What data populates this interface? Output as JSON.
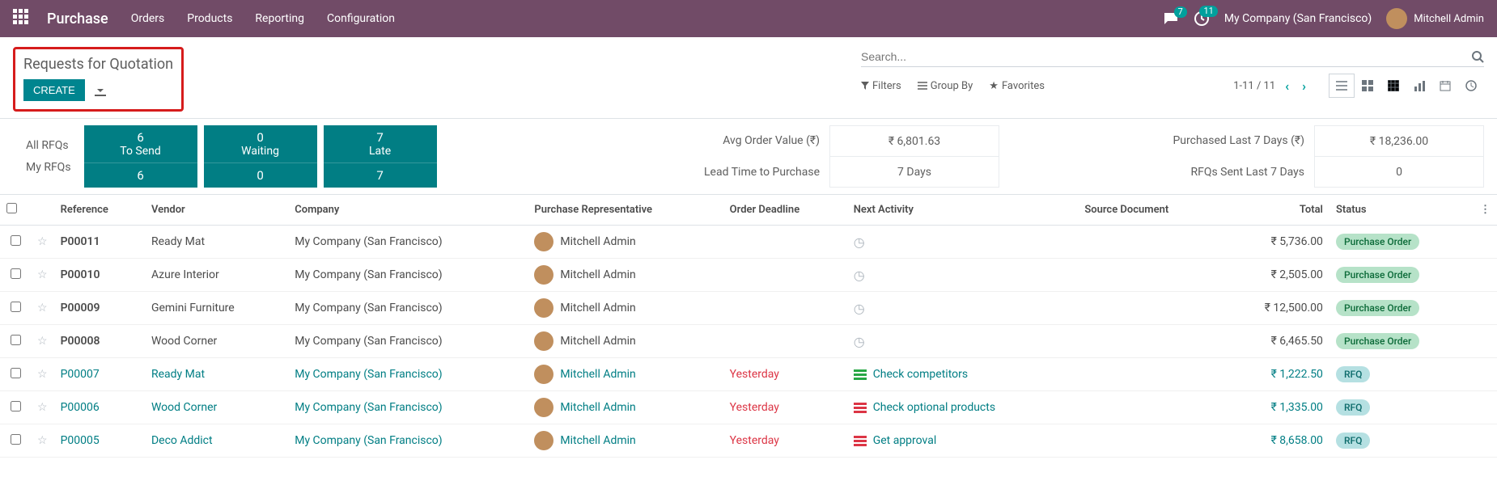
{
  "topnav": {
    "brand": "Purchase",
    "links": [
      "Orders",
      "Products",
      "Reporting",
      "Configuration"
    ],
    "chat_badge": "7",
    "activity_badge": "11",
    "company": "My Company (San Francisco)",
    "user": "Mitchell Admin"
  },
  "control": {
    "breadcrumb": "Requests for Quotation",
    "create": "CREATE",
    "search_placeholder": "Search...",
    "filters": "Filters",
    "groupby": "Group By",
    "favorites": "Favorites",
    "pager": "1-11 / 11"
  },
  "dashboard": {
    "row_labels": [
      "All RFQs",
      "My RFQs"
    ],
    "cards": [
      {
        "top_num": "6",
        "top_label": "To Send",
        "bottom": "6"
      },
      {
        "top_num": "0",
        "top_label": "Waiting",
        "bottom": "0"
      },
      {
        "top_num": "7",
        "top_label": "Late",
        "bottom": "7"
      }
    ],
    "mid_labels": [
      "Avg Order Value (₹)",
      "Lead Time to Purchase"
    ],
    "mid_values": [
      "₹ 6,801.63",
      "7  Days"
    ],
    "right_labels": [
      "Purchased Last 7 Days (₹)",
      "RFQs Sent Last 7 Days"
    ],
    "right_values": [
      "₹ 18,236.00",
      "0"
    ]
  },
  "table": {
    "headers": {
      "reference": "Reference",
      "vendor": "Vendor",
      "company": "Company",
      "rep": "Purchase Representative",
      "deadline": "Order Deadline",
      "activity": "Next Activity",
      "source": "Source Document",
      "total": "Total",
      "status": "Status"
    },
    "rows": [
      {
        "ref": "P00011",
        "vendor": "Ready Mat",
        "company": "My Company (San Francisco)",
        "rep": "Mitchell Admin",
        "deadline": "",
        "activity_type": "clock",
        "activity_text": "",
        "total": "₹ 5,736.00",
        "status": "Purchase Order",
        "status_class": "po",
        "link": false
      },
      {
        "ref": "P00010",
        "vendor": "Azure Interior",
        "company": "My Company (San Francisco)",
        "rep": "Mitchell Admin",
        "deadline": "",
        "activity_type": "clock",
        "activity_text": "",
        "total": "₹ 2,505.00",
        "status": "Purchase Order",
        "status_class": "po",
        "link": false
      },
      {
        "ref": "P00009",
        "vendor": "Gemini Furniture",
        "company": "My Company (San Francisco)",
        "rep": "Mitchell Admin",
        "deadline": "",
        "activity_type": "clock",
        "activity_text": "",
        "total": "₹ 12,500.00",
        "status": "Purchase Order",
        "status_class": "po",
        "link": false
      },
      {
        "ref": "P00008",
        "vendor": "Wood Corner",
        "company": "My Company (San Francisco)",
        "rep": "Mitchell Admin",
        "deadline": "",
        "activity_type": "clock",
        "activity_text": "",
        "total": "₹ 6,465.50",
        "status": "Purchase Order",
        "status_class": "po",
        "link": false
      },
      {
        "ref": "P00007",
        "vendor": "Ready Mat",
        "company": "My Company (San Francisco)",
        "rep": "Mitchell Admin",
        "deadline": "Yesterday",
        "activity_type": "bars-green",
        "activity_text": "Check competitors",
        "total": "₹ 1,222.50",
        "status": "RFQ",
        "status_class": "rfq",
        "link": true
      },
      {
        "ref": "P00006",
        "vendor": "Wood Corner",
        "company": "My Company (San Francisco)",
        "rep": "Mitchell Admin",
        "deadline": "Yesterday",
        "activity_type": "bars-red",
        "activity_text": "Check optional products",
        "total": "₹ 1,335.00",
        "status": "RFQ",
        "status_class": "rfq",
        "link": true
      },
      {
        "ref": "P00005",
        "vendor": "Deco Addict",
        "company": "My Company (San Francisco)",
        "rep": "Mitchell Admin",
        "deadline": "Yesterday",
        "activity_type": "bars-red",
        "activity_text": "Get approval",
        "total": "₹ 8,658.00",
        "status": "RFQ",
        "status_class": "rfq",
        "link": true
      }
    ]
  }
}
